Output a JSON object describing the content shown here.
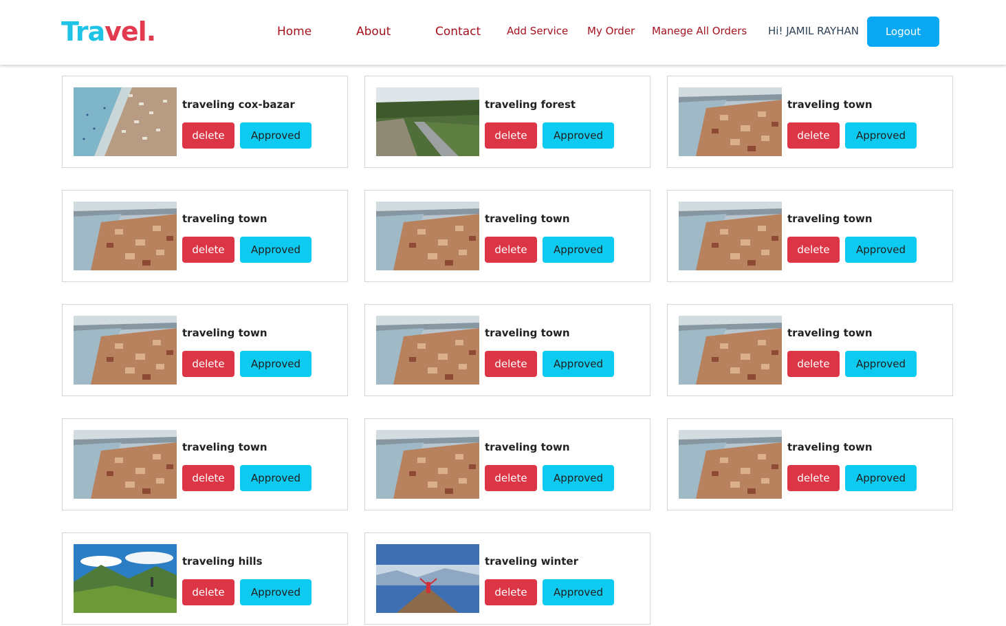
{
  "brand": {
    "part1": "Tra",
    "part2": "vel",
    "dot": "."
  },
  "nav": {
    "home": "Home",
    "about": "About",
    "contact": "Contact",
    "add_service": "Add Service",
    "my_order": "My Order",
    "manage_orders": "Manege All Orders",
    "greeting": "Hi! JAMIL RAYHAN",
    "logout": "Logout"
  },
  "colors": {
    "brand_cyan": "#1ec3e6",
    "brand_red": "#e23a4e",
    "nav_link": "#a5121e",
    "delete_button": "#dc3545",
    "approved_button": "#0dcaf0",
    "logout_button": "#0aa8f3"
  },
  "orders": [
    {
      "title": "traveling cox-bazar",
      "image": "beach-photo",
      "delete_label": "delete",
      "status_label": "Approved"
    },
    {
      "title": "traveling forest",
      "image": "forest-road-photo",
      "delete_label": "delete",
      "status_label": "Approved"
    },
    {
      "title": "traveling town",
      "image": "coastal-town-photo",
      "delete_label": "delete",
      "status_label": "Approved"
    },
    {
      "title": "traveling town",
      "image": "coastal-town-photo",
      "delete_label": "delete",
      "status_label": "Approved"
    },
    {
      "title": "traveling town",
      "image": "coastal-town-photo",
      "delete_label": "delete",
      "status_label": "Approved"
    },
    {
      "title": "traveling town",
      "image": "coastal-town-photo",
      "delete_label": "delete",
      "status_label": "Approved"
    },
    {
      "title": "traveling town",
      "image": "coastal-town-photo",
      "delete_label": "delete",
      "status_label": "Approved"
    },
    {
      "title": "traveling town",
      "image": "coastal-town-photo",
      "delete_label": "delete",
      "status_label": "Approved"
    },
    {
      "title": "traveling town",
      "image": "coastal-town-photo",
      "delete_label": "delete",
      "status_label": "Approved"
    },
    {
      "title": "traveling town",
      "image": "coastal-town-photo",
      "delete_label": "delete",
      "status_label": "Approved"
    },
    {
      "title": "traveling town",
      "image": "coastal-town-photo",
      "delete_label": "delete",
      "status_label": "Approved"
    },
    {
      "title": "traveling town",
      "image": "coastal-town-photo",
      "delete_label": "delete",
      "status_label": "Approved"
    },
    {
      "title": "traveling hills",
      "image": "mountain-hiker-photo",
      "delete_label": "delete",
      "status_label": "Approved"
    },
    {
      "title": "traveling winter",
      "image": "summit-hiker-photo",
      "delete_label": "delete",
      "status_label": "Approved"
    }
  ]
}
